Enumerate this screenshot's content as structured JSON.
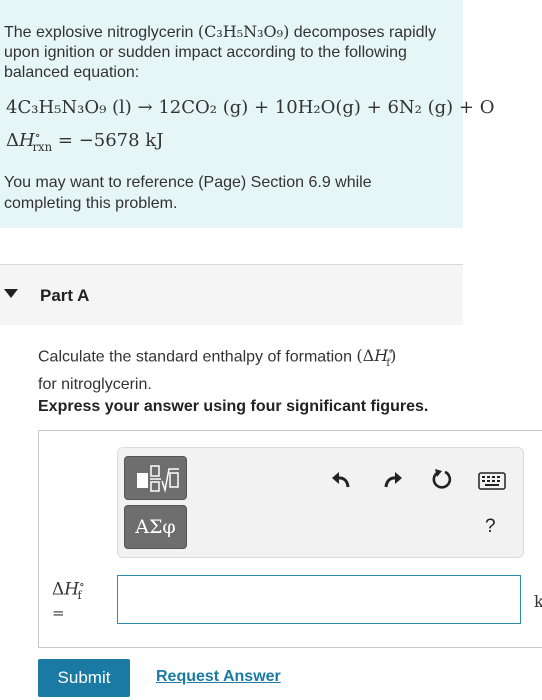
{
  "problem": {
    "intro_pre": "The explosive nitroglycerin ",
    "intro_formula": "(C₃H₅N₃O₉)",
    "intro_post": " decomposes rapidly upon ignition or sudden impact according to the following balanced equation:",
    "equation": "4C₃H₅N₃O₉ (l) → 12CO₂ (g) + 10H₂O(g) + 6N₂ (g) + O",
    "enthalpy_value": "= −5678 kJ",
    "reference": "You may want to reference (Page) Section 6.9 while completing this problem."
  },
  "part": {
    "title": "Part A",
    "question_pre": "Calculate the standard enthalpy of formation ",
    "question_post": " for nitroglycerin.",
    "instruction": "Express your answer using four significant figures."
  },
  "toolbar": {
    "greek_label": "ΑΣφ",
    "help_label": "?"
  },
  "answer": {
    "equals": "=",
    "value": "",
    "unit": "k"
  },
  "actions": {
    "submit_label": "Submit",
    "request_label": "Request Answer"
  },
  "colors": {
    "problem_bg": "#e6f5f5",
    "accent": "#1b7aa3",
    "input_border": "#2a8dab"
  }
}
